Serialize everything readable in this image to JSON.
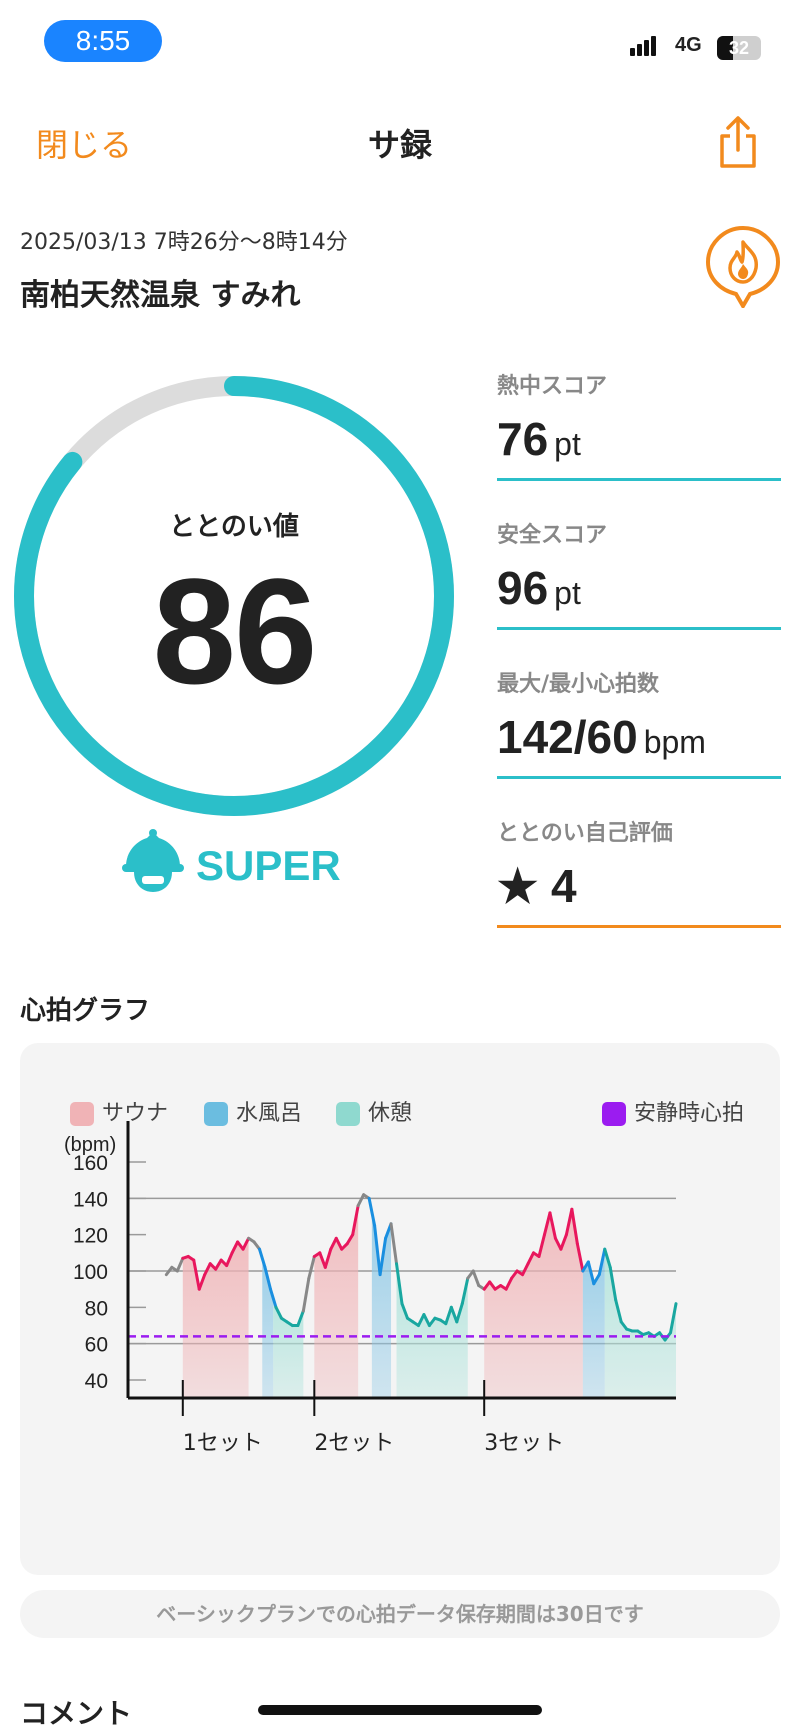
{
  "status_bar": {
    "time": "8:55",
    "network": "4G",
    "battery": "32"
  },
  "nav": {
    "close_label": "閉じる",
    "title": "サ録"
  },
  "session": {
    "datetime": "2025/03/13 7時26分〜8時14分",
    "facility": "南柏天然温泉 すみれ"
  },
  "totonoi": {
    "label": "ととのい値",
    "value": "86",
    "progress_fraction": 0.86,
    "rank": "SUPER"
  },
  "stats": [
    {
      "label": "熱中スコア",
      "value": "76",
      "unit": "pt"
    },
    {
      "label": "安全スコア",
      "value": "96",
      "unit": "pt"
    },
    {
      "label": "最大/最小心拍数",
      "value": "142/60",
      "unit": "bpm"
    },
    {
      "label": "ととのい自己評価",
      "value": "★ 4",
      "unit": ""
    }
  ],
  "graph_section": {
    "title": "心拍グラフ"
  },
  "chart_data": {
    "type": "area",
    "ylabel": "(bpm)",
    "ylim": [
      40,
      160
    ],
    "yticks": [
      160,
      140,
      120,
      100,
      80,
      60,
      40
    ],
    "legend": [
      {
        "name": "サウナ",
        "color": "#f0b3b6"
      },
      {
        "name": "水風呂",
        "color": "#6bbde0"
      },
      {
        "name": "休憩",
        "color": "#8fd9cf"
      },
      {
        "name": "安静時心拍",
        "color": "#9b1cf0"
      }
    ],
    "resting_hr": 64,
    "x_range": [
      0,
      100
    ],
    "set_labels": [
      {
        "label": "1セット",
        "x": 10
      },
      {
        "label": "2セット",
        "x": 34
      },
      {
        "label": "3セット",
        "x": 65
      }
    ],
    "phases": [
      {
        "type": "sauna",
        "start": 10,
        "end": 22
      },
      {
        "type": "cold",
        "start": 24.5,
        "end": 26.5
      },
      {
        "type": "rest",
        "start": 26.5,
        "end": 32
      },
      {
        "type": "sauna",
        "start": 34,
        "end": 42
      },
      {
        "type": "cold",
        "start": 44.5,
        "end": 48
      },
      {
        "type": "rest",
        "start": 49,
        "end": 62
      },
      {
        "type": "sauna",
        "start": 65,
        "end": 83
      },
      {
        "type": "cold",
        "start": 83,
        "end": 87
      },
      {
        "type": "rest",
        "start": 87,
        "end": 100
      }
    ],
    "hr_series": [
      [
        7,
        98
      ],
      [
        8,
        102
      ],
      [
        9,
        100
      ],
      [
        10,
        107
      ],
      [
        11,
        108
      ],
      [
        12,
        106
      ],
      [
        13,
        90
      ],
      [
        14,
        98
      ],
      [
        15,
        104
      ],
      [
        16,
        101
      ],
      [
        17,
        106
      ],
      [
        18,
        103
      ],
      [
        19,
        110
      ],
      [
        20,
        116
      ],
      [
        21,
        112
      ],
      [
        22,
        118
      ],
      [
        23,
        116
      ],
      [
        24,
        112
      ],
      [
        25,
        102
      ],
      [
        26,
        90
      ],
      [
        27,
        80
      ],
      [
        28,
        74
      ],
      [
        29,
        72
      ],
      [
        30,
        70
      ],
      [
        31,
        70
      ],
      [
        32,
        78
      ],
      [
        33,
        96
      ],
      [
        34,
        108
      ],
      [
        35,
        110
      ],
      [
        36,
        102
      ],
      [
        37,
        112
      ],
      [
        38,
        118
      ],
      [
        39,
        112
      ],
      [
        40,
        115
      ],
      [
        41,
        120
      ],
      [
        42,
        136
      ],
      [
        43,
        142
      ],
      [
        44,
        140
      ],
      [
        45,
        125
      ],
      [
        46,
        98
      ],
      [
        47,
        118
      ],
      [
        48,
        126
      ],
      [
        49,
        104
      ],
      [
        50,
        82
      ],
      [
        51,
        74
      ],
      [
        52,
        72
      ],
      [
        53,
        70
      ],
      [
        54,
        76
      ],
      [
        55,
        70
      ],
      [
        56,
        74
      ],
      [
        57,
        73
      ],
      [
        58,
        71
      ],
      [
        59,
        80
      ],
      [
        60,
        72
      ],
      [
        61,
        82
      ],
      [
        62,
        96
      ],
      [
        63,
        100
      ],
      [
        64,
        92
      ],
      [
        65,
        90
      ],
      [
        66,
        94
      ],
      [
        67,
        90
      ],
      [
        68,
        92
      ],
      [
        69,
        90
      ],
      [
        70,
        96
      ],
      [
        71,
        100
      ],
      [
        72,
        98
      ],
      [
        73,
        104
      ],
      [
        74,
        110
      ],
      [
        75,
        108
      ],
      [
        76,
        120
      ],
      [
        77,
        132
      ],
      [
        78,
        118
      ],
      [
        79,
        112
      ],
      [
        80,
        120
      ],
      [
        81,
        134
      ],
      [
        82,
        115
      ],
      [
        83,
        100
      ],
      [
        84,
        105
      ],
      [
        85,
        93
      ],
      [
        86,
        98
      ],
      [
        87,
        112
      ],
      [
        88,
        102
      ],
      [
        89,
        84
      ],
      [
        90,
        72
      ],
      [
        91,
        68
      ],
      [
        92,
        67
      ],
      [
        93,
        67
      ],
      [
        94,
        65
      ],
      [
        95,
        66
      ],
      [
        96,
        64
      ],
      [
        97,
        66
      ],
      [
        98,
        62
      ],
      [
        99,
        66
      ],
      [
        100,
        82
      ]
    ]
  },
  "notice": "ベーシックプランでの心拍データ保存期間は30日です",
  "comment_title": "コメント"
}
